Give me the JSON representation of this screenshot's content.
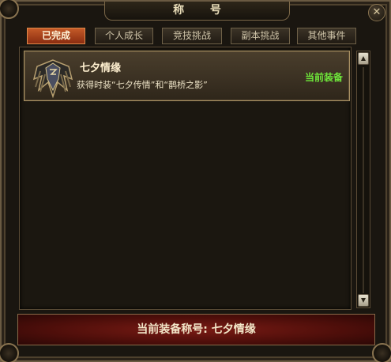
{
  "window": {
    "title": "称 号",
    "close_glyph": "✕"
  },
  "tabs": [
    {
      "label": "已完成",
      "active": true
    },
    {
      "label": "个人成长",
      "active": false
    },
    {
      "label": "竞技挑战",
      "active": false
    },
    {
      "label": "副本挑战",
      "active": false
    },
    {
      "label": "其他事件",
      "active": false
    }
  ],
  "titles_list": [
    {
      "name": "七夕情缘",
      "description": "获得时装“七夕传情”和“鹊桥之影”",
      "status": "当前装备",
      "icon": "winged-shield-emblem-icon"
    }
  ],
  "footer": {
    "current_title_text": "当前装备称号: 七夕情缘"
  },
  "colors": {
    "active_tab": "#b8481e",
    "status_green": "#6ee63a",
    "footer_red": "#6a1610",
    "frame_gold": "#8a7450"
  }
}
